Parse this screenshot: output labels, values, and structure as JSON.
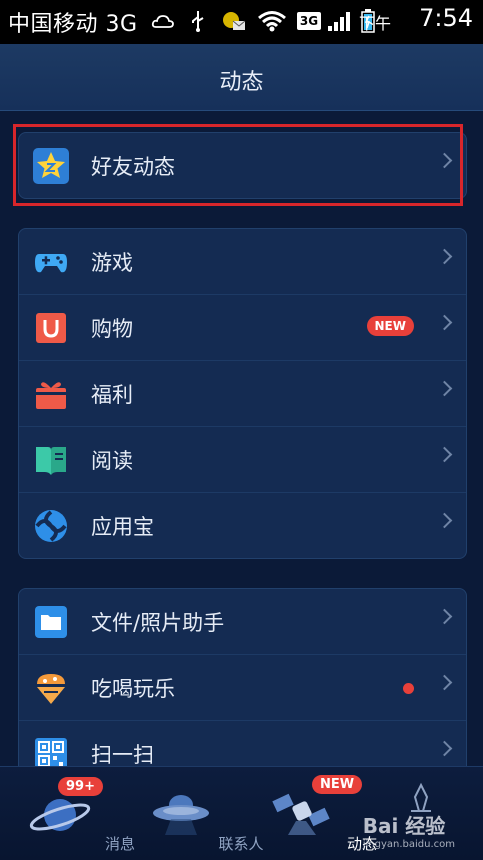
{
  "status_bar": {
    "carrier": "中国移动 3G",
    "network": "3G",
    "ampm": "下午",
    "time": "7:54"
  },
  "header": {
    "title": "动态"
  },
  "groups": [
    {
      "items": [
        {
          "label": "好友动态",
          "icon": "friends-star-icon"
        }
      ]
    },
    {
      "items": [
        {
          "label": "游戏",
          "icon": "gamepad-icon"
        },
        {
          "label": "购物",
          "icon": "shopping-bag-icon",
          "badge": "NEW"
        },
        {
          "label": "福利",
          "icon": "gift-icon"
        },
        {
          "label": "阅读",
          "icon": "book-icon"
        },
        {
          "label": "应用宝",
          "icon": "app-store-icon"
        }
      ]
    },
    {
      "items": [
        {
          "label": "文件/照片助手",
          "icon": "folder-icon"
        },
        {
          "label": "吃喝玩乐",
          "icon": "food-icon",
          "dot": true
        },
        {
          "label": "扫一扫",
          "icon": "qr-code-icon"
        }
      ]
    }
  ],
  "tabs": [
    {
      "label": "消息",
      "badge": "99+"
    },
    {
      "label": "联系人"
    },
    {
      "label": "动态",
      "badge": "NEW",
      "active": true
    },
    {
      "label": ""
    }
  ],
  "watermark": {
    "brand": "Bai 经验",
    "url": "jingyan.baidu.com"
  },
  "colors": {
    "accent_red": "#e8403a",
    "background": "#0b1a38",
    "highlight_box": "#d8262b"
  }
}
